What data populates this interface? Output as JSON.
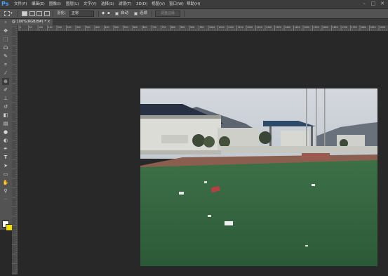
{
  "app": {
    "logo": "Ps"
  },
  "menu": [
    "文件(F)",
    "编辑(E)",
    "图像(I)",
    "图层(L)",
    "文字(Y)",
    "选择(S)",
    "滤镜(T)",
    "3D(D)",
    "视图(V)",
    "窗口(W)",
    "帮助(H)"
  ],
  "window_controls": {
    "minimize": "–",
    "maximize": "□",
    "close": "✕"
  },
  "options_bar": {
    "feather_label": "羽化:",
    "feather_value": "正常",
    "antialias_label": "自动",
    "contiguous_label": "连续",
    "refine_button": "调整边缘"
  },
  "document": {
    "tab_title": "@ 100%(RGB/8#) *",
    "close_glyph": "×"
  },
  "ruler": {
    "labels": [
      "0",
      "50",
      "100",
      "150",
      "200",
      "250",
      "300",
      "350",
      "400",
      "450",
      "500",
      "550",
      "600",
      "650",
      "700",
      "750",
      "800",
      "850",
      "900",
      "950",
      "1000",
      "1050",
      "1100",
      "1150",
      "1200",
      "1250",
      "1300",
      "1350",
      "1400",
      "1450",
      "1500",
      "1550",
      "1600",
      "1650",
      "1700",
      "1750",
      "1800",
      "1850",
      "1900",
      "1950"
    ]
  },
  "colors": {
    "foreground": "#ffffff",
    "background": "#f0e000",
    "accent": "#4aa3ff"
  },
  "tools": [
    "move-tool-icon",
    "marquee-tool-icon",
    "lasso-tool-icon",
    "quick-select-tool-icon",
    "crop-tool-icon",
    "eyedropper-tool-icon",
    "healing-brush-tool-icon",
    "brush-tool-icon",
    "clone-stamp-tool-icon",
    "history-brush-tool-icon",
    "eraser-tool-icon",
    "gradient-tool-icon",
    "blur-tool-icon",
    "dodge-tool-icon",
    "pen-tool-icon",
    "type-tool-icon",
    "path-select-tool-icon",
    "shape-tool-icon",
    "hand-tool-icon",
    "zoom-tool-icon"
  ]
}
